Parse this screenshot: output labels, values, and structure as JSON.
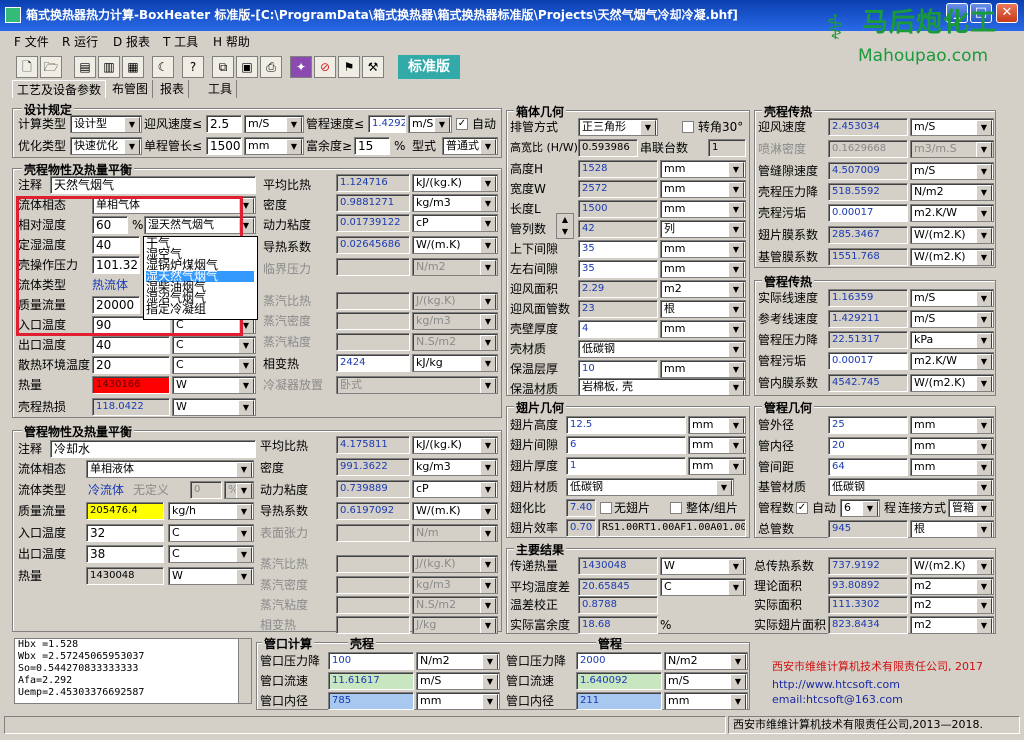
{
  "window": {
    "title": "箱式换热器热力计算-BoxHeater 标准版-[C:\\ProgramData\\箱式换热器\\箱式换热器标准版\\Projects\\天然气烟气冷却冷凝.bhf]",
    "min": "_",
    "max": "□",
    "close": "✕"
  },
  "menu": [
    "F 文件",
    "R 运行",
    "D 报表",
    "T 工具",
    "H 帮助"
  ],
  "toolbar_label": "标准版",
  "logo": {
    "name": "马后炮化工",
    "url": "Mahoupao.com"
  },
  "tabs": [
    "工艺及设备参数",
    "布管图",
    "报表",
    "工具"
  ],
  "design": {
    "title": "设计规定",
    "calc_type_label": "计算类型",
    "calc_type": "设计型",
    "face_speed_label": "迎风速度≤",
    "face_speed": "2.5",
    "face_speed_unit": "m/S",
    "tube_speed_label": "管程速度≤",
    "tube_speed": "1.42921",
    "tube_speed_unit": "m/S",
    "auto_label": "自动",
    "opt_type_label": "优化类型",
    "opt_type": "快速优化",
    "tube_len_label": "单程管长≤",
    "tube_len": "1500",
    "tube_len_unit": "mm",
    "margin_label": "富余度≥",
    "margin": "15",
    "margin_unit": "%",
    "type_label": "型式",
    "type": "普通式"
  },
  "shell": {
    "title": "壳程物性及热量平衡",
    "note_label": "注释",
    "note": "天然气烟气",
    "phase_label": "流体相态",
    "phase": "单相气体",
    "humidity_label": "相对湿度",
    "humidity": "60",
    "humidity_unit": "%",
    "fluid_sel": "湿天然气烟气",
    "dew_label": "定湿温度",
    "dew": "40",
    "pressure_label": "壳操作压力",
    "pressure": "101.325",
    "fluid_type_label": "流体类型",
    "fluid_type": "热流体",
    "mass_flow_label": "质量流量",
    "mass_flow": "20000",
    "in_temp_label": "入口温度",
    "in_temp": "90",
    "in_temp_unit": "C",
    "out_temp_label": "出口温度",
    "out_temp": "40",
    "out_temp_unit": "C",
    "env_temp_label": "散热环境温度",
    "env_temp": "20",
    "env_temp_unit": "C",
    "heat_label": "热量",
    "heat": "1430166",
    "heat_unit": "W",
    "loss_label": "壳程热损",
    "loss": "118.0422",
    "loss_unit": "W",
    "cp_label": "平均比热",
    "cp": "1.124716",
    "cp_unit": "kJ/(kg.K)",
    "rho_label": "密度",
    "rho": "0.9881271",
    "rho_unit": "kg/m3",
    "mu_label": "动力粘度",
    "mu": "0.01739122",
    "mu_unit": "cP",
    "k_label": "导热系数",
    "k": "0.02645686",
    "k_unit": "W/(m.K)",
    "pc_label": "临界压力",
    "pc_unit": "N/m2",
    "vcp_label": "蒸汽比热",
    "vcp_unit": "J/(kg.K)",
    "vrho_label": "蒸汽密度",
    "vrho_unit": "kg/m3",
    "vmu_label": "蒸汽粘度",
    "vmu_unit": "N.S/m2",
    "latent_label": "相变热",
    "latent": "2424",
    "latent_unit": "kJ/kg",
    "cond_label": "冷凝器放置",
    "cond": "卧式"
  },
  "dropdown": [
    "干气",
    "湿空气",
    "湿锅炉煤烟气",
    "湿天然气烟气",
    "湿柴油烟气",
    "湿沼气烟气",
    "指定冷凝组"
  ],
  "tube": {
    "title": "管程物性及热量平衡",
    "note_label": "注释",
    "note": "冷却水",
    "phase_label": "流体相态",
    "phase": "单相液体",
    "fluid_type_label": "流体类型",
    "fluid_type": "冷流体",
    "undefined": "无定义",
    "undef_val": "0",
    "undef_unit": "%",
    "mass_flow_label": "质量流量",
    "mass_flow": "205476.4",
    "mass_flow_unit": "kg/h",
    "in_temp_label": "入口温度",
    "in_temp": "32",
    "in_temp_unit": "C",
    "out_temp_label": "出口温度",
    "out_temp": "38",
    "out_temp_unit": "C",
    "heat_label": "热量",
    "heat": "1430048",
    "heat_unit": "W",
    "cp_label": "平均比热",
    "cp": "4.175811",
    "cp_unit": "kJ/(kg.K)",
    "rho_label": "密度",
    "rho": "991.3622",
    "rho_unit": "kg/m3",
    "mu_label": "动力粘度",
    "mu": "0.739889",
    "mu_unit": "cP",
    "k_label": "导热系数",
    "k": "0.6197092",
    "k_unit": "W/(m.K)",
    "st_label": "表面张力",
    "st_unit": "N/m",
    "vcp_label": "蒸汽比热",
    "vcp_unit": "J/(kg.K)",
    "vrho_label": "蒸汽密度",
    "vrho_unit": "kg/m3",
    "vmu_label": "蒸汽粘度",
    "vmu_unit": "N.S/m2",
    "latent_label": "相变热",
    "latent_unit": "J/kg"
  },
  "log": [
    "Hbx  =1.528",
    "Wbx  =2.57245065953037",
    "So=0.544270833333333",
    "Afa=2.292",
    "Uemp=2.45303376692587"
  ],
  "nozzle": {
    "title": "管口计算",
    "shell": "壳程",
    "tube": "管程",
    "dp_label": "管口压力降",
    "shell_dp": "100",
    "shell_dp_unit": "N/m2",
    "shell_v_label": "管口流速",
    "shell_v": "11.61617",
    "shell_v_unit": "m/S",
    "shell_d_label": "管口内径",
    "shell_d": "785",
    "shell_d_unit": "mm",
    "tube_dp": "2000",
    "tube_dp_unit": "N/m2",
    "tube_v": "1.640092",
    "tube_v_unit": "m/S",
    "tube_d": "211",
    "tube_d_unit": "mm"
  },
  "box": {
    "title": "箱体几何",
    "arr_label": "排管方式",
    "arr": "正三角形",
    "rot_label": "转角30°",
    "hw_label": "高宽比 (H/W)",
    "hw": "0.593986",
    "series_label": "串联台数",
    "series": "1",
    "h_label": "高度H",
    "h": "1528",
    "h_unit": "mm",
    "w_label": "宽度W",
    "w": "2572",
    "w_unit": "mm",
    "l_label": "长度L",
    "l": "1500",
    "l_unit": "mm",
    "rows_label": "管列数",
    "rows": "42",
    "rows_unit": "列",
    "ud_label": "上下间隙",
    "ud": "35",
    "ud_unit": "mm",
    "lr_label": "左右间隙",
    "lr": "35",
    "lr_unit": "mm",
    "fa_label": "迎风面积",
    "fa": "2.29",
    "fa_unit": "m2",
    "fr_label": "迎风面管数",
    "fr": "23",
    "fr_unit": "根",
    "wall_label": "壳壁厚度",
    "wall": "4",
    "wall_unit": "mm",
    "mat_label": "壳材质",
    "mat": "低碳钢",
    "ins_label": "保温层厚",
    "ins": "10",
    "ins_unit": "mm",
    "insmat_label": "保温材质",
    "insmat": "岩棉板, 壳"
  },
  "fin": {
    "title": "翅片几何",
    "fh_label": "翅片高度",
    "fh": "12.5",
    "fh_unit": "mm",
    "fg_label": "翅片间隙",
    "fg": "6",
    "fg_unit": "mm",
    "ft_label": "翅片厚度",
    "ft": "1",
    "ft_unit": "mm",
    "fm_label": "翅片材质",
    "fm": "低碳钢",
    "fr_label": "翅化比",
    "fr": "7.40",
    "nofin_label": "无翅片",
    "whole_label": "整体/组片",
    "fe_label": "翅片效率",
    "fe": "0.70",
    "code": "RS1.00RT1.00AF1.00A01.00"
  },
  "shellht": {
    "title": "壳程传热",
    "v_label": "迎风速度",
    "v": "2.453034",
    "v_unit": "m/S",
    "spray_label": "喷淋密度",
    "spray": "0.1629668",
    "spray_unit": "m3/m.S",
    "gap_label": "管缝隙速度",
    "gap": "4.507009",
    "gap_unit": "m/S",
    "dp_label": "壳程压力降",
    "dp": "518.5592",
    "dp_unit": "N/m2",
    "foul_label": "壳程污垢",
    "foul": "0.00017",
    "foul_unit": "m2.K/W",
    "fin_label": "翅片膜系数",
    "fin": "285.3467",
    "fin_unit": "W/(m2.K)",
    "base_label": "基管膜系数",
    "base": "1551.768",
    "base_unit": "W/(m2.K)"
  },
  "tubeht": {
    "title": "管程传热",
    "v_label": "实际线速度",
    "v": "1.16359",
    "v_unit": "m/S",
    "ref_label": "参考线速度",
    "ref": "1.429211",
    "ref_unit": "m/S",
    "dp_label": "管程压力降",
    "dp": "22.51317",
    "dp_unit": "kPa",
    "foul_label": "管程污垢",
    "foul": "0.00017",
    "foul_unit": "m2.K/W",
    "in_label": "管内膜系数",
    "in": "4542.745",
    "in_unit": "W/(m2.K)"
  },
  "tubegeo": {
    "title": "管程几何",
    "od_label": "管外径",
    "od": "25",
    "od_unit": "mm",
    "id_label": "管内径",
    "id": "20",
    "id_unit": "mm",
    "pitch_label": "管间距",
    "pitch": "64",
    "pitch_unit": "mm",
    "mat_label": "基管材质",
    "mat": "低碳钢",
    "passes_label": "管程数",
    "auto_label": "自动",
    "passes": "6",
    "pass_label": "程",
    "conn_label": "连接方式",
    "conn": "管箱",
    "total_label": "总管数",
    "total": "945",
    "total_unit": "根"
  },
  "results": {
    "title": "主要结果",
    "q_label": "传递热量",
    "q": "1430048",
    "q_unit": "W",
    "lmtd_label": "平均温度差",
    "lmtd": "20.65845",
    "lmtd_unit": "C",
    "corr_label": "温差校正",
    "corr": "0.8788",
    "margin_label": "实际富余度",
    "margin": "18.68",
    "margin_unit": "%",
    "u_label": "总传热系数",
    "u": "737.9192",
    "u_unit": "W/(m2.K)",
    "theo_label": "理论面积",
    "theo": "93.80892",
    "theo_unit": "m2",
    "act_label": "实际面积",
    "act": "111.3302",
    "act_unit": "m2",
    "fin_label": "实际翅片面积",
    "fin": "823.8434",
    "fin_unit": "m2"
  },
  "company": {
    "name": "西安市维维计算机技术有限责任公司, 2017",
    "url": "http://www.htcsoft.com",
    "email": "email:htcsoft@163.com"
  },
  "status": "西安市维维计算机技术有限责任公司,2013—2018."
}
